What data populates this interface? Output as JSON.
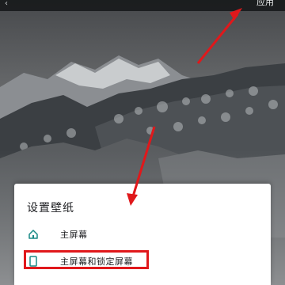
{
  "topbar": {
    "apply_label": "应用"
  },
  "sheet": {
    "title": "设置壁纸",
    "options": [
      {
        "label": "主屏幕",
        "icon": "home-icon"
      },
      {
        "label": "主屏幕和锁定屏幕",
        "icon": "phone-icon"
      }
    ]
  },
  "colors": {
    "annotation": "#e0181b",
    "sheet_bg": "#ffffff",
    "icon_teal": "#1a8a85"
  }
}
